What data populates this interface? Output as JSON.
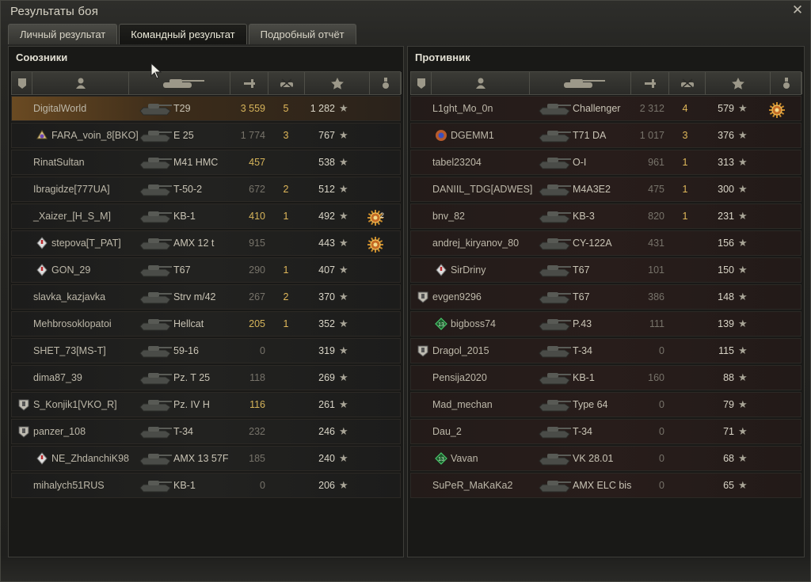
{
  "window": {
    "title": "Результаты боя",
    "close_icon": "close-icon"
  },
  "tabs": [
    {
      "label": "Личный результат",
      "active": false
    },
    {
      "label": "Командный результат",
      "active": true
    },
    {
      "label": "Подробный отчёт",
      "active": false
    }
  ],
  "allies": {
    "title": "Союзники",
    "rows": [
      {
        "player": "DigitalWorld",
        "tank": "T29",
        "damage": "3 559",
        "damage_hi": true,
        "kills": "5",
        "xp": "1 282",
        "badge": "",
        "medal": "",
        "me": true
      },
      {
        "player": "FARA_voin_8[BKO]",
        "tank": "E 25",
        "damage": "1 774",
        "damage_hi": false,
        "kills": "3",
        "xp": "767",
        "badge": "rank-gold",
        "medal": ""
      },
      {
        "player": "RinatSultan",
        "tank": "M41 HMC",
        "damage": "457",
        "damage_hi": true,
        "kills": "",
        "xp": "538",
        "badge": "",
        "medal": ""
      },
      {
        "player": "Ibragidze[777UA]",
        "tank": "T-50-2",
        "damage": "672",
        "damage_hi": false,
        "kills": "2",
        "xp": "512",
        "badge": "",
        "medal": ""
      },
      {
        "player": "_Xaizer_[H_S_M]",
        "tank": "KB-1",
        "damage": "410",
        "damage_hi": true,
        "kills": "1",
        "xp": "492",
        "badge": "",
        "medal": "sun",
        "medal_count": "2"
      },
      {
        "player": "stepova[T_PAT]",
        "tank": "AMX 12 t",
        "damage": "915",
        "damage_hi": false,
        "kills": "",
        "xp": "443",
        "badge": "rank-red",
        "medal": "sun"
      },
      {
        "player": "GON_29",
        "tank": "T67",
        "damage": "290",
        "damage_hi": false,
        "kills": "1",
        "xp": "407",
        "badge": "rank-red",
        "medal": ""
      },
      {
        "player": "slavka_kazjavka",
        "tank": "Strv m/42",
        "damage": "267",
        "damage_hi": false,
        "kills": "2",
        "xp": "370",
        "badge": "",
        "medal": ""
      },
      {
        "player": "Mehbrosoklopatoi",
        "tank": "Hellcat",
        "damage": "205",
        "damage_hi": true,
        "kills": "1",
        "xp": "352",
        "badge": "",
        "medal": ""
      },
      {
        "player": "SHET_73[MS-T]",
        "tank": "59-16",
        "damage": "0",
        "damage_hi": false,
        "kills": "",
        "xp": "319",
        "badge": "",
        "medal": ""
      },
      {
        "player": "dima87_39",
        "tank": "Pz. T 25",
        "damage": "118",
        "damage_hi": false,
        "kills": "",
        "xp": "269",
        "badge": "",
        "medal": ""
      },
      {
        "player": "S_Konjik1[VKO_R]",
        "tank": "Pz. IV H",
        "damage": "116",
        "damage_hi": true,
        "kills": "",
        "xp": "261",
        "badge": "shield",
        "medal": ""
      },
      {
        "player": "panzer_108",
        "tank": "T-34",
        "damage": "232",
        "damage_hi": false,
        "kills": "",
        "xp": "246",
        "badge": "shield",
        "medal": ""
      },
      {
        "player": "NE_ZhdanchiK98",
        "tank": "AMX 13 57F",
        "damage": "185",
        "damage_hi": false,
        "kills": "",
        "xp": "240",
        "badge": "rank-red",
        "medal": ""
      },
      {
        "player": "mihalych51RUS",
        "tank": "KB-1",
        "damage": "0",
        "damage_hi": false,
        "kills": "",
        "xp": "206",
        "badge": "",
        "medal": ""
      }
    ]
  },
  "enemies": {
    "title": "Противник",
    "rows": [
      {
        "player": "L1ght_Mo_0n",
        "tank": "Challenger",
        "damage": "2 312",
        "damage_hi": false,
        "kills": "4",
        "xp": "579",
        "badge": "",
        "medal": "sun"
      },
      {
        "player": "DGEMM1",
        "tank": "T71 DA",
        "damage": "1 017",
        "damage_hi": false,
        "kills": "3",
        "xp": "376",
        "badge": "rank-star",
        "medal": ""
      },
      {
        "player": "tabel23204",
        "tank": "O-I",
        "damage": "961",
        "damage_hi": false,
        "kills": "1",
        "xp": "313",
        "badge": "",
        "medal": ""
      },
      {
        "player": "DANIIL_TDG[ADWES]",
        "tank": "M4A3E2",
        "damage": "475",
        "damage_hi": false,
        "kills": "1",
        "xp": "300",
        "badge": "",
        "medal": ""
      },
      {
        "player": "bnv_82",
        "tank": "KB-3",
        "damage": "820",
        "damage_hi": false,
        "kills": "1",
        "xp": "231",
        "badge": "",
        "medal": ""
      },
      {
        "player": "andrej_kiryanov_80",
        "tank": "CY-122A",
        "damage": "431",
        "damage_hi": false,
        "kills": "",
        "xp": "156",
        "badge": "",
        "medal": ""
      },
      {
        "player": "SirDriny",
        "tank": "T67",
        "damage": "101",
        "damage_hi": false,
        "kills": "",
        "xp": "150",
        "badge": "rank-red",
        "medal": ""
      },
      {
        "player": "evgen9296",
        "tank": "T67",
        "damage": "386",
        "damage_hi": false,
        "kills": "",
        "xp": "148",
        "badge": "shield",
        "medal": ""
      },
      {
        "player": "bigboss74",
        "tank": "P.43",
        "damage": "111",
        "damage_hi": false,
        "kills": "",
        "xp": "139",
        "badge": "rank-13",
        "medal": ""
      },
      {
        "player": "Dragol_2015",
        "tank": "T-34",
        "damage": "0",
        "damage_hi": false,
        "kills": "",
        "xp": "115",
        "badge": "shield",
        "medal": ""
      },
      {
        "player": "Pensija2020",
        "tank": "KB-1",
        "damage": "160",
        "damage_hi": false,
        "kills": "",
        "xp": "88",
        "badge": "",
        "medal": ""
      },
      {
        "player": "Mad_mechan",
        "tank": "Type 64",
        "damage": "0",
        "damage_hi": false,
        "kills": "",
        "xp": "79",
        "badge": "",
        "medal": ""
      },
      {
        "player": "Dau_2",
        "tank": "T-34",
        "damage": "0",
        "damage_hi": false,
        "kills": "",
        "xp": "71",
        "badge": "",
        "medal": ""
      },
      {
        "player": "Vavan",
        "tank": "VK 28.01",
        "damage": "0",
        "damage_hi": false,
        "kills": "",
        "xp": "68",
        "badge": "rank-13",
        "medal": ""
      },
      {
        "player": "SuPeR_MaKaKa2",
        "tank": "AMX ELC bis",
        "damage": "0",
        "damage_hi": false,
        "kills": "",
        "xp": "65",
        "badge": "",
        "medal": ""
      }
    ]
  },
  "columns": [
    "platoon-icon",
    "player-icon",
    "tank-icon",
    "damage-icon",
    "kills-icon",
    "experience-star-icon",
    "medal-icon"
  ],
  "badge_13_label": "13",
  "star_glyph": "★",
  "colors": {
    "accent": "#d6b45a",
    "enemy_row": "#281d1b",
    "ally_row": "#222220"
  }
}
